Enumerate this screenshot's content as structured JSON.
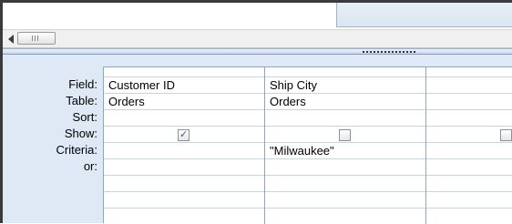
{
  "row_labels": {
    "field": "Field:",
    "table": "Table:",
    "sort": "Sort:",
    "show": "Show:",
    "criteria": "Criteria:",
    "or": "or:"
  },
  "columns": [
    {
      "field": "Customer ID",
      "table": "Orders",
      "sort": "",
      "show": true,
      "criteria": ""
    },
    {
      "field": "Ship City",
      "table": "Orders",
      "sort": "",
      "show": false,
      "criteria": "\"Milwaukee\""
    },
    {
      "field": "",
      "table": "",
      "sort": "",
      "show": false,
      "criteria": ""
    }
  ],
  "icons": {
    "scroll_left": "scroll-left-arrow-icon",
    "check": "checkmark-icon"
  },
  "colors": {
    "grid_background": "#dfe8f5",
    "grid_border": "#8aa6c9",
    "checkmark": "#2b5ea8"
  }
}
